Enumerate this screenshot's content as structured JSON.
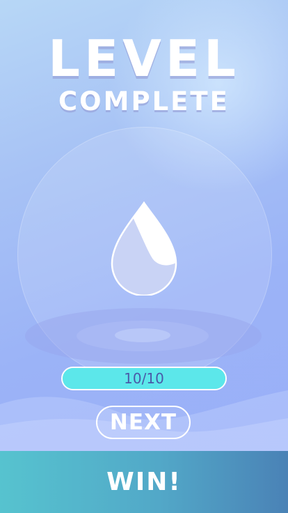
{
  "title": {
    "line1": "LEVEL",
    "line2": "COMPLETE"
  },
  "icon": {
    "name": "water-drop-icon"
  },
  "progress": {
    "text": "10/10",
    "current": 10,
    "total": 10,
    "fill_fraction": 1.0,
    "fill_color": "#5ce7ea"
  },
  "buttons": {
    "next_label": "NEXT"
  },
  "footer": {
    "label": "WIN!"
  },
  "colors": {
    "background_top": "#b7d7f6",
    "background_bottom": "#9aaef8",
    "footer_left": "#56c3cf",
    "footer_right": "#4a82b6"
  }
}
